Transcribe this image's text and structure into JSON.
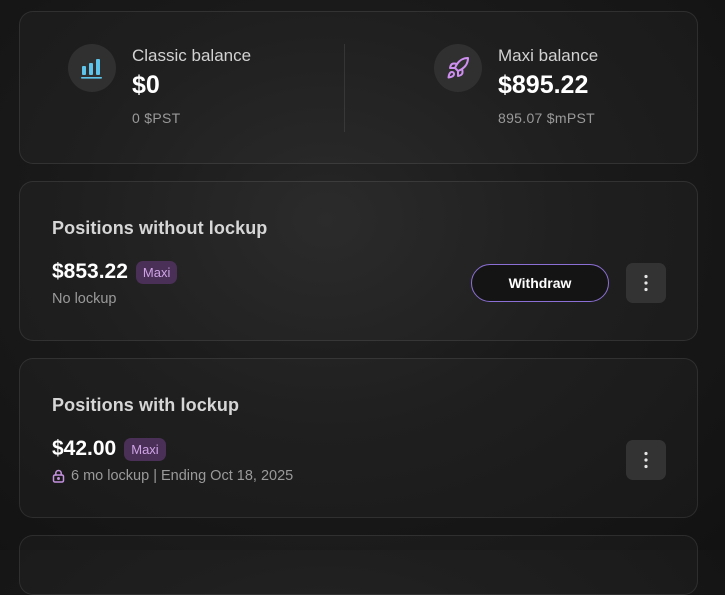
{
  "balances": {
    "classic": {
      "label": "Classic balance",
      "value": "$0",
      "sub": "0 $PST",
      "icon": "bar-chart-icon",
      "icon_color": "#5ec4ea"
    },
    "maxi": {
      "label": "Maxi balance",
      "value": "$895.22",
      "sub": "895.07 $mPST",
      "icon": "rocket-icon",
      "icon_color": "#cf8ff0"
    }
  },
  "positions_without_lockup": {
    "title": "Positions without lockup",
    "amount": "$853.22",
    "tag": "Maxi",
    "sub": "No lockup",
    "withdraw_label": "Withdraw",
    "more_icon": "more-vertical-icon"
  },
  "positions_with_lockup": {
    "title": "Positions with lockup",
    "amount": "$42.00",
    "tag": "Maxi",
    "lock_icon": "lock-icon",
    "lock_color": "#c592e0",
    "sub": "6 mo lockup | Ending Oct 18, 2025",
    "more_icon": "more-vertical-icon"
  },
  "colors": {
    "accent_purple": "#8b6fd4",
    "tag_background": "#4a2f57",
    "tag_text": "#cfa4e6"
  }
}
